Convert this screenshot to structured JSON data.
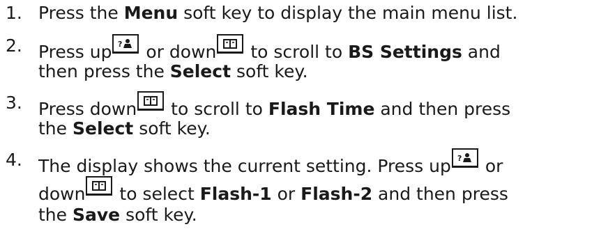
{
  "steps": [
    {
      "num": "1.",
      "l1": {
        "a": "Press the ",
        "b": "Menu",
        "c": " soft key to display the main menu list."
      }
    },
    {
      "num": "2.",
      "l1": {
        "a": "Press up",
        "c": " or down",
        "e": " to scroll to ",
        "f": "BS Settings",
        "g": " and"
      },
      "l2": {
        "a": "then press the ",
        "b": "Select",
        "c": " soft key."
      }
    },
    {
      "num": "3.",
      "l1": {
        "a": "Press down",
        "c": " to scroll to ",
        "d": "Flash Time",
        "e": " and then press"
      },
      "l2": {
        "a": "the ",
        "b": "Select",
        "c": " soft key."
      }
    },
    {
      "num": "4.",
      "l1": {
        "a": "The display shows the current setting.  Press up",
        "c": " or"
      },
      "l2": {
        "a": "down",
        "c": " to select ",
        "d": "Flash-1",
        "e": " or ",
        "f": "Flash-2",
        "g": " and then press"
      },
      "l3": {
        "a": "the ",
        "b": "Save",
        "c": " soft key."
      }
    }
  ],
  "icons": {
    "up": "phonebook-up-key-icon",
    "down": "book-down-key-icon"
  }
}
